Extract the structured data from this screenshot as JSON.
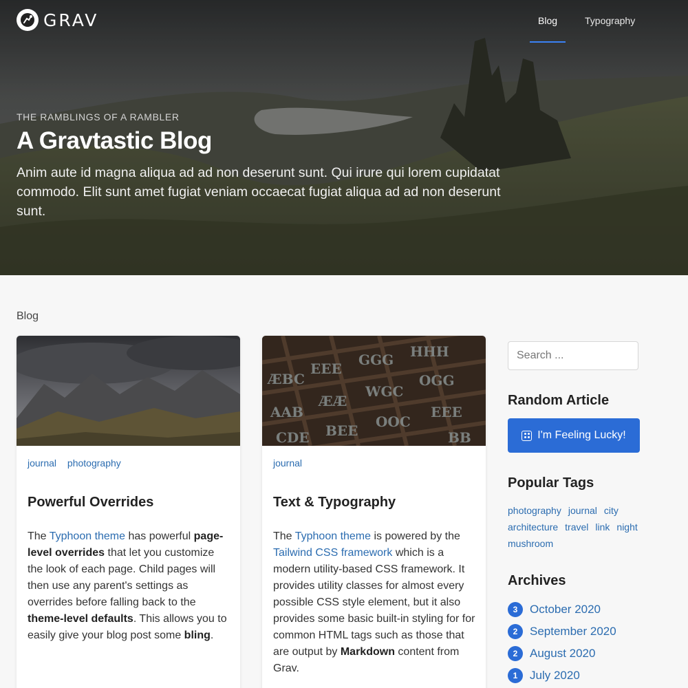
{
  "site": {
    "logo_text": "GRAV"
  },
  "nav": {
    "items": [
      {
        "label": "Blog",
        "active": true
      },
      {
        "label": "Typography",
        "active": false
      }
    ]
  },
  "hero": {
    "kicker": "THE RAMBLINGS OF A RAMBLER",
    "title": "A Gravtastic Blog",
    "description": "Anim aute id magna aliqua ad ad non deserunt sunt. Qui irure qui lorem cupidatat commodo. Elit sunt amet fugiat veniam occaecat fugiat aliqua ad ad non deserunt sunt."
  },
  "breadcrumb": "Blog",
  "cards": [
    {
      "tags": [
        "journal",
        "photography"
      ],
      "title": "Powerful Overrides",
      "body": {
        "t1": "The ",
        "l1": "Typhoon theme",
        "t2": " has powerful ",
        "b1": "page-level overrides",
        "t3": " that let you customize the look of each page. Child pages will then use any parent's settings as overrides before falling back to the ",
        "b2": "theme-level defaults",
        "t4": ". This allows you to easily give your blog post some ",
        "b3": "bling",
        "t5": "."
      }
    },
    {
      "tags": [
        "journal"
      ],
      "title": "Text & Typography",
      "body": {
        "t1": "The ",
        "l1": "Typhoon theme",
        "t2": " is powered by the ",
        "l2": "Tailwind CSS framework",
        "t3": " which is a modern utility-based CSS framework. It provides utility classes for almost every possible CSS style element, but it also provides some basic built-in styling for for common HTML tags such as those that are output by ",
        "b1": "Markdown",
        "t4": " content from Grav."
      }
    }
  ],
  "sidebar": {
    "search_placeholder": "Search ...",
    "random_heading": "Random Article",
    "lucky_label": "I'm Feeling Lucky!",
    "tags_heading": "Popular Tags",
    "tags": [
      "photography",
      "journal",
      "city",
      "architecture",
      "travel",
      "link",
      "night",
      "mushroom"
    ],
    "archives_heading": "Archives",
    "archives": [
      {
        "count": "3",
        "label": "October 2020"
      },
      {
        "count": "2",
        "label": "September 2020"
      },
      {
        "count": "2",
        "label": "August 2020"
      },
      {
        "count": "1",
        "label": "July 2020"
      }
    ]
  },
  "colors": {
    "accent": "#2b6cd6",
    "link": "#2b6cb0",
    "nav_underline": "#3b82f6"
  },
  "icons": {
    "logo": "grav-logo-icon",
    "lucky": "dice-icon"
  }
}
